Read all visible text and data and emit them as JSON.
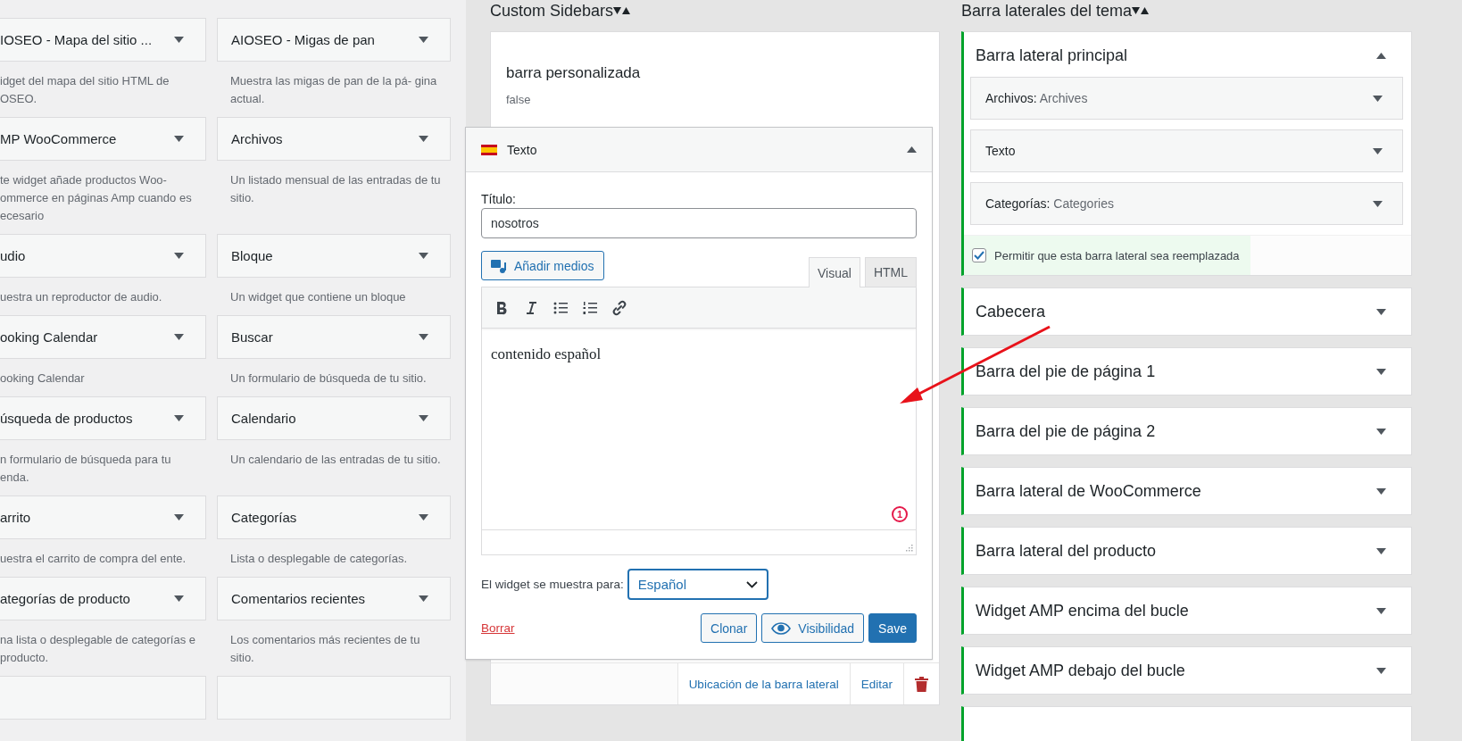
{
  "available_widgets": [
    {
      "title": "IOSEO - Mapa del sitio ...",
      "description": "idget del mapa del sitio HTML de OSEO."
    },
    {
      "title": "AIOSEO - Migas de pan",
      "description": "Muestra las migas de pan de la pá- gina actual."
    },
    {
      "title": "MP WooCommerce",
      "description": "te widget añade productos Woo- ommerce en páginas Amp cuando es ecesario"
    },
    {
      "title": "Archivos",
      "description": "Un listado mensual de las entradas de tu sitio."
    },
    {
      "title": "udio",
      "description": "uestra un reproductor de audio."
    },
    {
      "title": "Bloque",
      "description": "Un widget que contiene un bloque"
    },
    {
      "title": "ooking Calendar",
      "description": "ooking Calendar"
    },
    {
      "title": "Buscar",
      "description": "Un formulario de búsqueda de tu sitio."
    },
    {
      "title": "úsqueda de productos",
      "description": "n formulario de búsqueda para tu enda."
    },
    {
      "title": "Calendario",
      "description": "Un calendario de las entradas de tu sitio."
    },
    {
      "title": "arrito",
      "description": "uestra el carrito de compra del ente."
    },
    {
      "title": "Categorías",
      "description": "Lista o desplegable de categorías."
    },
    {
      "title": "ategorías de producto",
      "description": "na lista o desplegable de categorías e producto."
    },
    {
      "title": "Comentarios recientes",
      "description": "Los comentarios más recientes de tu sitio."
    }
  ],
  "custom_sidebars": {
    "heading": "Custom Sidebars",
    "sidebar": {
      "title": "barra personalizada",
      "description": "false",
      "footer_links": [
        "Ubicación de la barra lateral",
        "Editar"
      ]
    }
  },
  "dragged_widget": {
    "title": "Texto",
    "expanded": true,
    "title_label": "Título:",
    "title_value": "nosotros",
    "add_media": "Añadir medios",
    "tabs": [
      {
        "label": "Visual",
        "selected": true
      },
      {
        "label": "HTML",
        "selected": false
      }
    ],
    "content": "contenido español",
    "badge": "1",
    "language_label": "El widget se muestra para:",
    "language_value": "Español",
    "delete_link": "Borrar",
    "buttons": [
      {
        "label": "Clonar",
        "kind": "secondary"
      },
      {
        "label": "Visibilidad",
        "kind": "secondary-icon"
      },
      {
        "label": "Save",
        "kind": "primary"
      }
    ]
  },
  "theme_sidebars": {
    "heading": "Barra laterales del tema",
    "sidebars": [
      {
        "title": "Barra lateral principal",
        "expanded": true,
        "widgets": [
          {
            "name": "Archivos:",
            "subtitle": "Archives"
          },
          {
            "name": "Texto"
          },
          {
            "name": "Categorías:",
            "subtitle": "Categories"
          }
        ],
        "replaceable": {
          "label": "Permitir que esta barra lateral sea reemplazada",
          "checked": true
        }
      },
      {
        "title": "Cabecera",
        "expanded": false
      },
      {
        "title": "Barra del pie de página 1",
        "expanded": false
      },
      {
        "title": "Barra del pie de página 2",
        "expanded": false
      },
      {
        "title": "Barra lateral de WooCommerce",
        "expanded": false
      },
      {
        "title": "Barra lateral del producto",
        "expanded": false
      },
      {
        "title": "Widget AMP encima del bucle",
        "expanded": false
      },
      {
        "title": "Widget AMP debajo del bucle",
        "expanded": false
      }
    ]
  }
}
